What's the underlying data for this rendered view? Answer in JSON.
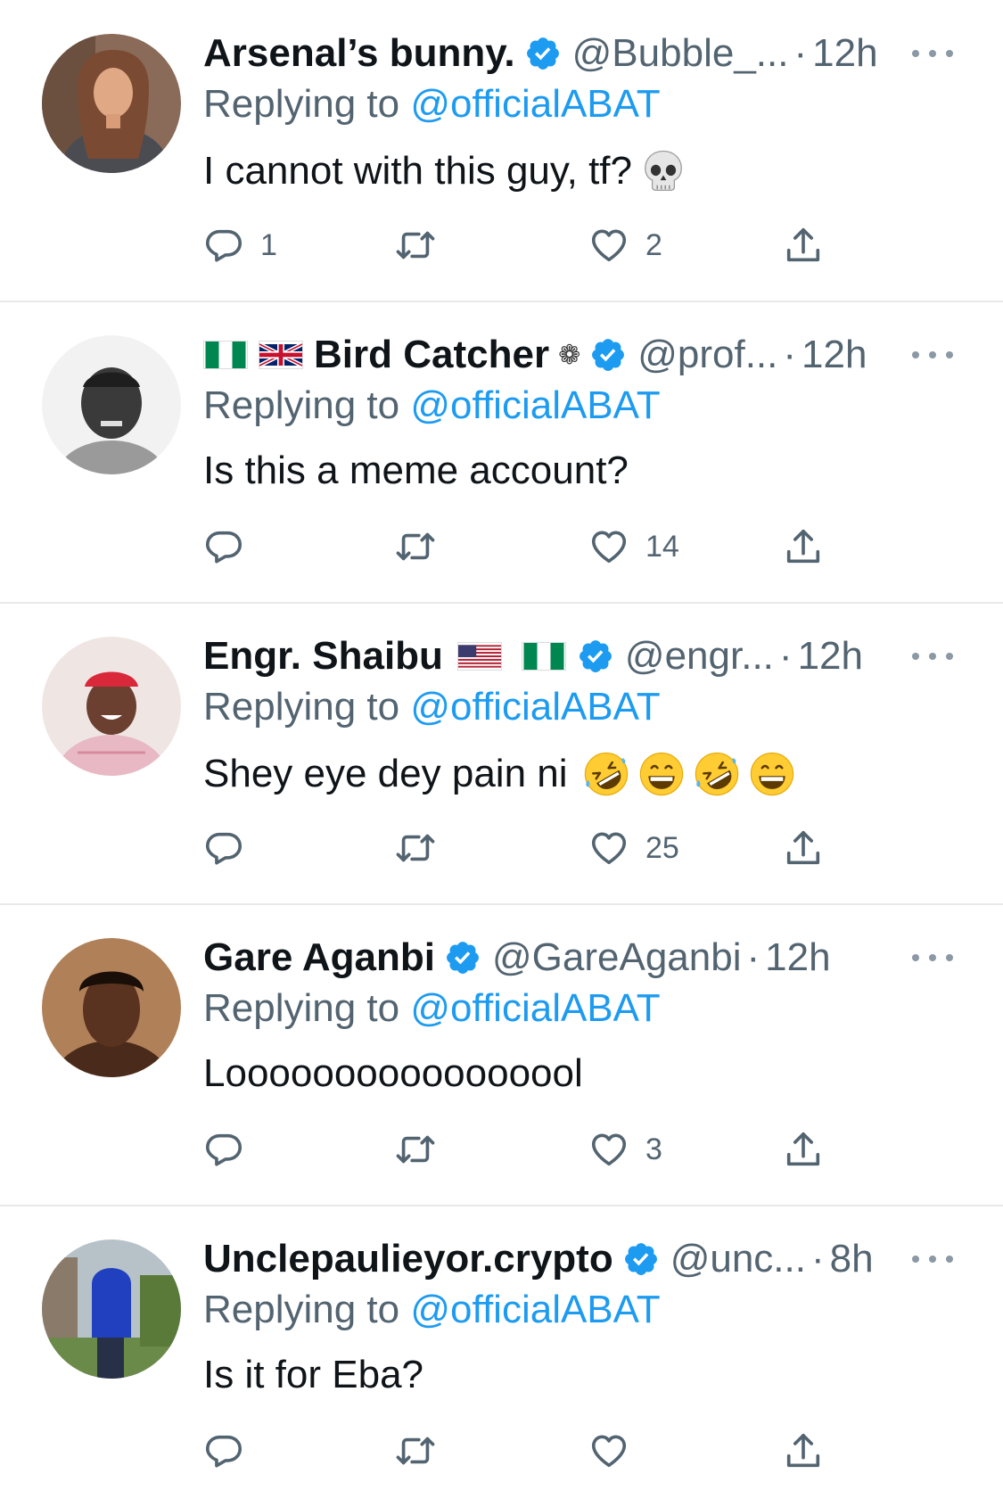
{
  "colors": {
    "link": "#1d9bf0",
    "muted": "#536471",
    "text": "#0f1419",
    "verified": "#1d9bf0"
  },
  "tweets": [
    {
      "name": "Arsenal’s bunny.",
      "handle": "@Bubble_...",
      "time": "12h",
      "replying_label": "Replying to",
      "replying_to": "@officialABAT",
      "text": "I cannot with this guy, tf?",
      "emojis": [
        "skull-emoji"
      ],
      "reply_count": "1",
      "retweet_count": "",
      "like_count": "2"
    },
    {
      "name": "Bird Catcher",
      "name_prefix_flags": [
        "nigeria-flag",
        "uk-flag"
      ],
      "name_suffix": "❁",
      "handle": "@prof...",
      "time": "12h",
      "replying_label": "Replying to",
      "replying_to": "@officialABAT",
      "text": "Is this a meme account?",
      "reply_count": "",
      "retweet_count": "",
      "like_count": "14"
    },
    {
      "name": "Engr. Shaibu",
      "name_suffix_flags": [
        "usa-flag",
        "nigeria-flag"
      ],
      "handle": "@engr...",
      "time": "12h",
      "replying_label": "Replying to",
      "replying_to": "@officialABAT",
      "text": "Shey eye dey pain ni",
      "emojis": [
        "rofl-emoji",
        "grin-emoji",
        "rofl-emoji",
        "grin-emoji"
      ],
      "reply_count": "",
      "retweet_count": "",
      "like_count": "25"
    },
    {
      "name": "Gare Aganbi",
      "handle": "@GareAganbi",
      "time": "12h",
      "replying_label": "Replying to",
      "replying_to": "@officialABAT",
      "text": "Looooooooooooooool",
      "reply_count": "",
      "retweet_count": "",
      "like_count": "3"
    },
    {
      "name": "Unclepaulieyor.crypto",
      "handle": "@unc...",
      "time": "8h",
      "replying_label": "Replying to",
      "replying_to": "@officialABAT",
      "text": "Is it for Eba?",
      "reply_count": "",
      "retweet_count": "",
      "like_count": ""
    }
  ]
}
